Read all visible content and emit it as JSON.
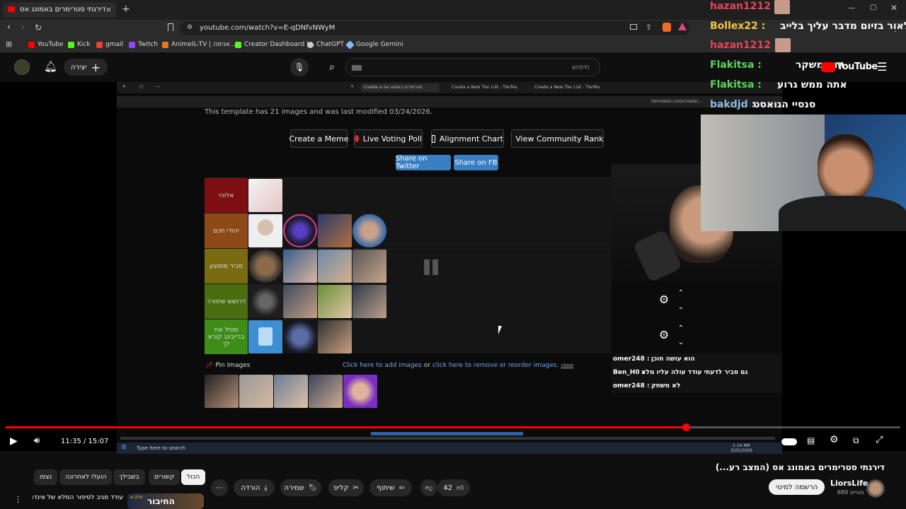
{
  "browser": {
    "tab_title": "דירגתי סטרימרים באמונג אס",
    "url": "youtube.com/watch?v=E-qDNfvNWyM",
    "bookmarks": [
      "YouTube",
      "Kick",
      "gmail",
      "Twitch",
      "AnimeIL-TV | אנימה...",
      "Creator Dashboard |...",
      "ChatGPT",
      "Google Gemini"
    ],
    "colors": {
      "accent": "#ff0000"
    }
  },
  "header": {
    "create_label": "יצירה",
    "search_placeholder": "חיפוש",
    "logo_text": "YouTube"
  },
  "video": {
    "inner_tabs": [
      "Create a סטרימרים באמונג אס",
      "Create a New Tier List - TierMa",
      "Create a New Tier List - TierMa"
    ],
    "inner_url": "tiermaker.com/create/...",
    "template_note": "This template has 21 images and was last modified 03/24/2026.",
    "buttons": {
      "create_meme": "Create a Meme",
      "live_poll": "Live Voting Poll",
      "alignment": "Alignment Chart",
      "community": "View Community Rank",
      "share_twitter": "Share on Twitter",
      "share_fb": "Share on FB"
    },
    "tiers": [
      {
        "label": "אלוהי",
        "color": "#7d0f12",
        "images": 1
      },
      {
        "label": "יהודי חכם",
        "color": "#8d4a16",
        "images": 4
      },
      {
        "label": "סביר ממוצע",
        "color": "#7a6b12",
        "images": 4
      },
      {
        "label": "דרושש שיפורר",
        "color": "#4a6d10",
        "images": 4
      },
      {
        "label": "סטיל אח ברייבינג קורא לך",
        "color": "#3e8d19",
        "images": 3
      }
    ],
    "pin_images_label": "Pin Images",
    "add_images_link": "Click here to add images",
    "or_text": "or",
    "reorder_link": "click here to remove or reorder images.",
    "close_link": "close",
    "overlay_chat_top": [
      {
        "user": "hazan1212 :",
        "text": "",
        "color": "#e8455a"
      },
      {
        "user": "Bollex22 :",
        "text": "לאור בזיום מדבר עליך בלייב",
        "color": "#f5c542"
      },
      {
        "user": "hazan1212 :",
        "text": "",
        "color": "#e8455a"
      },
      {
        "user": "Flakitsa :",
        "text": "הוא משקר",
        "color": "#5dd35d"
      },
      {
        "user": "Flakitsa :",
        "text": "אתה ממש גרוע",
        "color": "#5dd35d"
      },
      {
        "user": "bakdjd :",
        "text": "סנסיי הגואסט",
        "color": "#8fb8e0"
      }
    ],
    "overlay_chat_bottom": [
      {
        "user": "omer248 :",
        "text": "הוא עושה חוכן"
      },
      {
        "user": "Ben_H0 :",
        "text": "גם סביר לדעתי עודד עולה עליו מלא"
      },
      {
        "user": "omer248 :",
        "text": "לא משחק"
      }
    ],
    "taskbar_search": "Type here to search",
    "taskbar_time": "1:14 AM",
    "taskbar_date": "3/25/2026",
    "time_current": "11:35",
    "time_total": "15:07",
    "time_display": "11:35 / 15:07",
    "progress_fraction": 0.76
  },
  "below": {
    "title": "דירגתי סטרימרים באמונג אס (המצב רע...)",
    "channel": "LiorsLife",
    "subs": "689 מנויים",
    "subscribe": "הרשמה למינוי",
    "likes": "42",
    "share": "שיתוף",
    "clip": "קליפ",
    "save": "שמירה",
    "download": "הורדה",
    "chips": [
      "הכול",
      "קשורים",
      "בשבילך",
      "הועלו לאחרונה",
      "נצפו"
    ],
    "next_video_title": "עודד מגיב לסיפור המלא של אינדה ...",
    "next_video_thumb_text": "החיבור",
    "next_video_badge": "חלק א"
  }
}
